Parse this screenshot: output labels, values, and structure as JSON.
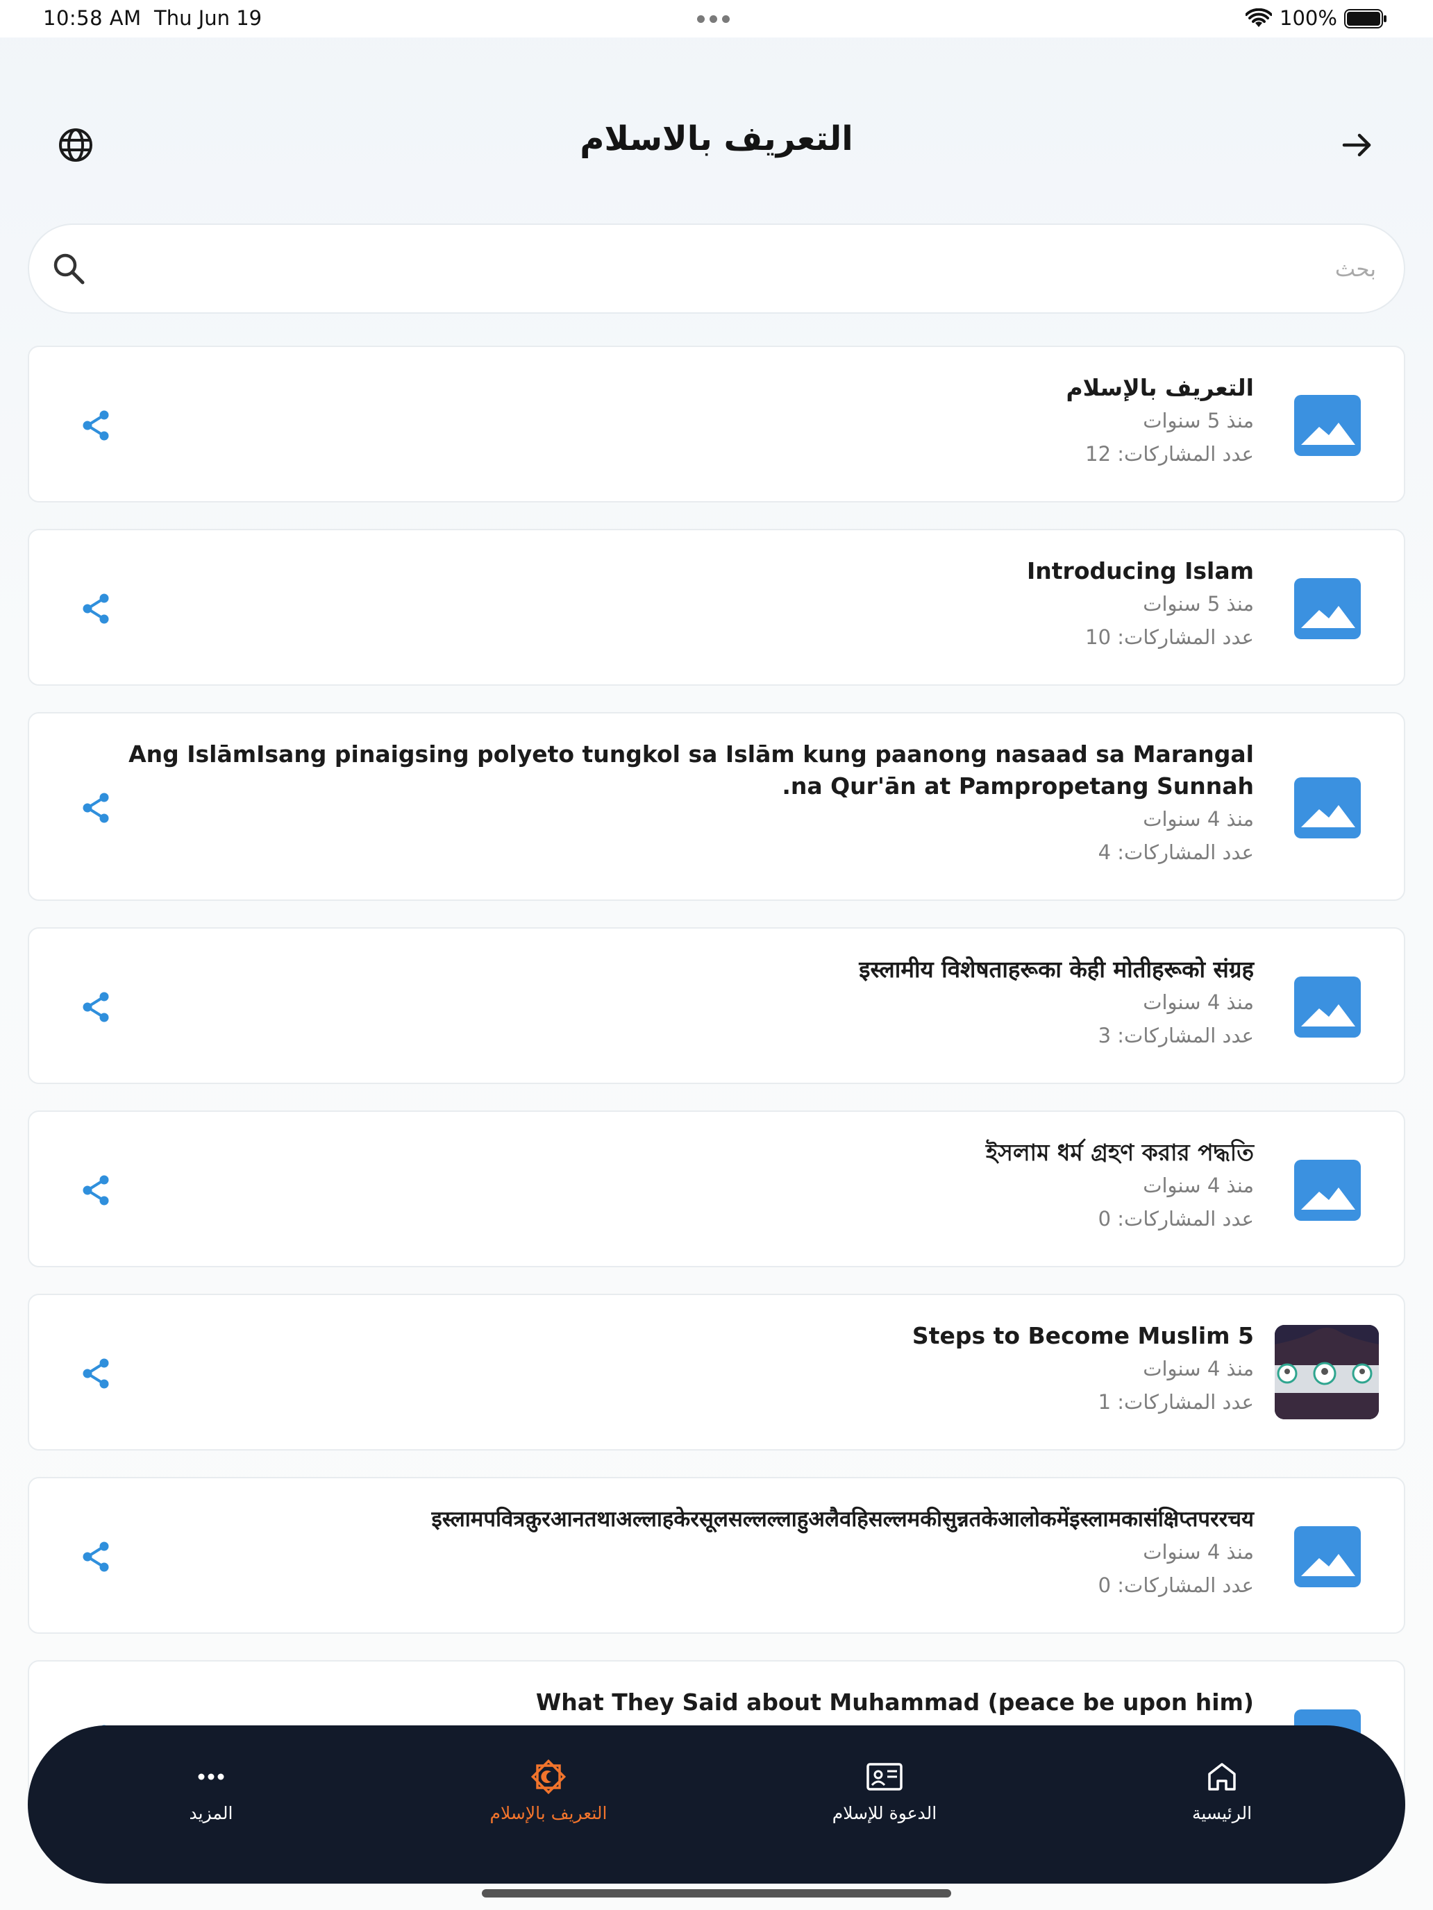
{
  "status_bar": {
    "time": "10:58 AM",
    "date": "Thu Jun 19",
    "battery": "100%"
  },
  "header": {
    "title": "التعريف بالاسلام"
  },
  "search": {
    "placeholder": "بحث"
  },
  "items": [
    {
      "title": "التعريف بالإسلام",
      "time": "منذ 5 سنوات",
      "shares": "عدد المشاركات: 12"
    },
    {
      "title": "Introducing Islam",
      "time": "منذ 5 سنوات",
      "shares": "عدد المشاركات: 10"
    },
    {
      "title": "Ang IslāmIsang pinaigsing polyeto tungkol sa Islām kung paanong nasaad sa Marangal na Qur'ān at Pampropetang Sunnah.",
      "time": "منذ 4 سنوات",
      "shares": "عدد المشاركات: 4"
    },
    {
      "title": "इस्लामीय विशेषताहरूका केही मोतीहरूको संग्रह",
      "time": "منذ 4 سنوات",
      "shares": "عدد المشاركات: 3"
    },
    {
      "title": "ইসলাম ধর্ম গ্রহণ করার পদ্ধতি",
      "time": "منذ 4 سنوات",
      "shares": "عدد المشاركات: 0"
    },
    {
      "title": "Steps to Become Muslim 5",
      "time": "منذ 4 سنوات",
      "shares": "عدد المشاركات: 1"
    },
    {
      "title": "इस्लामपवित्रक़ुरआनतथाअल्लाहकेरसूलसल्लल्लाहुअलैवहिसल्लमकीसुन्नतकेआलोकमेंइस्लामकासंक्षिप्तपररचय",
      "time": "منذ 4 سنوات",
      "shares": "عدد المشاركات: 0"
    },
    {
      "title": "What They Said about Muhammad (peace be upon him)"
    }
  ],
  "nav": {
    "more": "المزيد",
    "intro_islam": "التعريف بالإسلام",
    "dawah": "الدعوة للإسلام",
    "home": "الرئيسية"
  },
  "colors": {
    "accent_blue": "#2f8fdc",
    "nav_background": "#121a2a",
    "nav_active": "#f2742c"
  }
}
